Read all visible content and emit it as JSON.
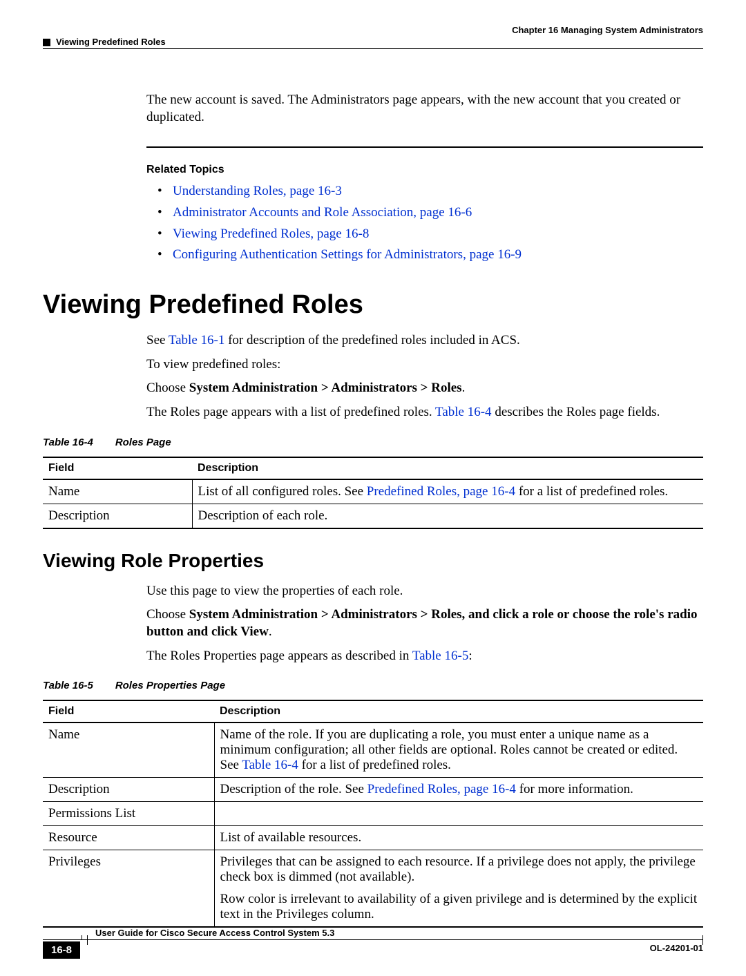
{
  "header": {
    "chapter_label": "Chapter 16    Managing System Administrators",
    "breadcrumb": "Viewing Predefined Roles"
  },
  "intro_paragraph": "The new account is saved. The Administrators page appears, with the new account that you created or duplicated.",
  "related_topics": {
    "heading": "Related Topics",
    "items": [
      "Understanding Roles, page 16-3",
      "Administrator Accounts and Role Association, page 16-6",
      "Viewing Predefined Roles, page 16-8",
      "Configuring Authentication Settings for Administrators, page 16-9"
    ]
  },
  "section1": {
    "heading": "Viewing Predefined Roles",
    "p1_a": "See ",
    "p1_link": "Table 16-1",
    "p1_b": " for description of the predefined roles included in ACS.",
    "p2": "To view predefined roles:",
    "p3_a": "Choose ",
    "p3_bold": "System Administration > Administrators > Roles",
    "p3_b": ".",
    "p4_a": "The Roles page appears with a list of predefined roles. ",
    "p4_link": "Table 16-4",
    "p4_b": " describes the Roles page fields."
  },
  "table16_4": {
    "caption_label": "Table 16-4",
    "caption_title": "Roles Page",
    "col_field": "Field",
    "col_desc": "Description",
    "rows": [
      {
        "field": "Name",
        "desc_a": "List of all configured roles. See ",
        "desc_link": "Predefined Roles, page 16-4",
        "desc_b": " for a list of predefined roles."
      },
      {
        "field": "Description",
        "desc_a": "Description of each role.",
        "desc_link": "",
        "desc_b": ""
      }
    ]
  },
  "section2": {
    "heading": "Viewing Role Properties",
    "p1": "Use this page to view the properties of each role.",
    "p2_a": "Choose ",
    "p2_bold": "System Administration > Administrators > Roles, and click a role or choose the role's radio button and click View",
    "p2_b": ".",
    "p3_a": "The Roles Properties page appears as described in ",
    "p3_link": "Table 16-5",
    "p3_b": ":"
  },
  "table16_5": {
    "caption_label": "Table 16-5",
    "caption_title": "Roles Properties Page",
    "col_field": "Field",
    "col_desc": "Description",
    "rows": [
      {
        "field": "Name",
        "desc_a": "Name of the role. If you are duplicating a role, you must enter a unique name as a minimum configuration; all other fields are optional. Roles cannot be created or edited. See ",
        "desc_link": "Table 16-4",
        "desc_b": " for a list of predefined roles."
      },
      {
        "field": "Description",
        "desc_a": "Description of the role. See ",
        "desc_link": "Predefined Roles, page 16-4",
        "desc_b": " for more information."
      },
      {
        "field": "Permissions List",
        "desc_a": "",
        "desc_link": "",
        "desc_b": ""
      },
      {
        "field": "Resource",
        "desc_a": "List of available resources.",
        "desc_link": "",
        "desc_b": ""
      },
      {
        "field": "Privileges",
        "desc_a": "Privileges that can be assigned to each resource. If a privilege does not apply, the privilege check box is dimmed (not available).",
        "desc_link": "",
        "desc_b": "",
        "extra": "Row color is irrelevant to availability of a given privilege and is determined by the explicit text in the Privileges column."
      }
    ]
  },
  "footer": {
    "guide_title": "User Guide for Cisco Secure Access Control System 5.3",
    "page_number": "16-8",
    "doc_code": "OL-24201-01"
  }
}
